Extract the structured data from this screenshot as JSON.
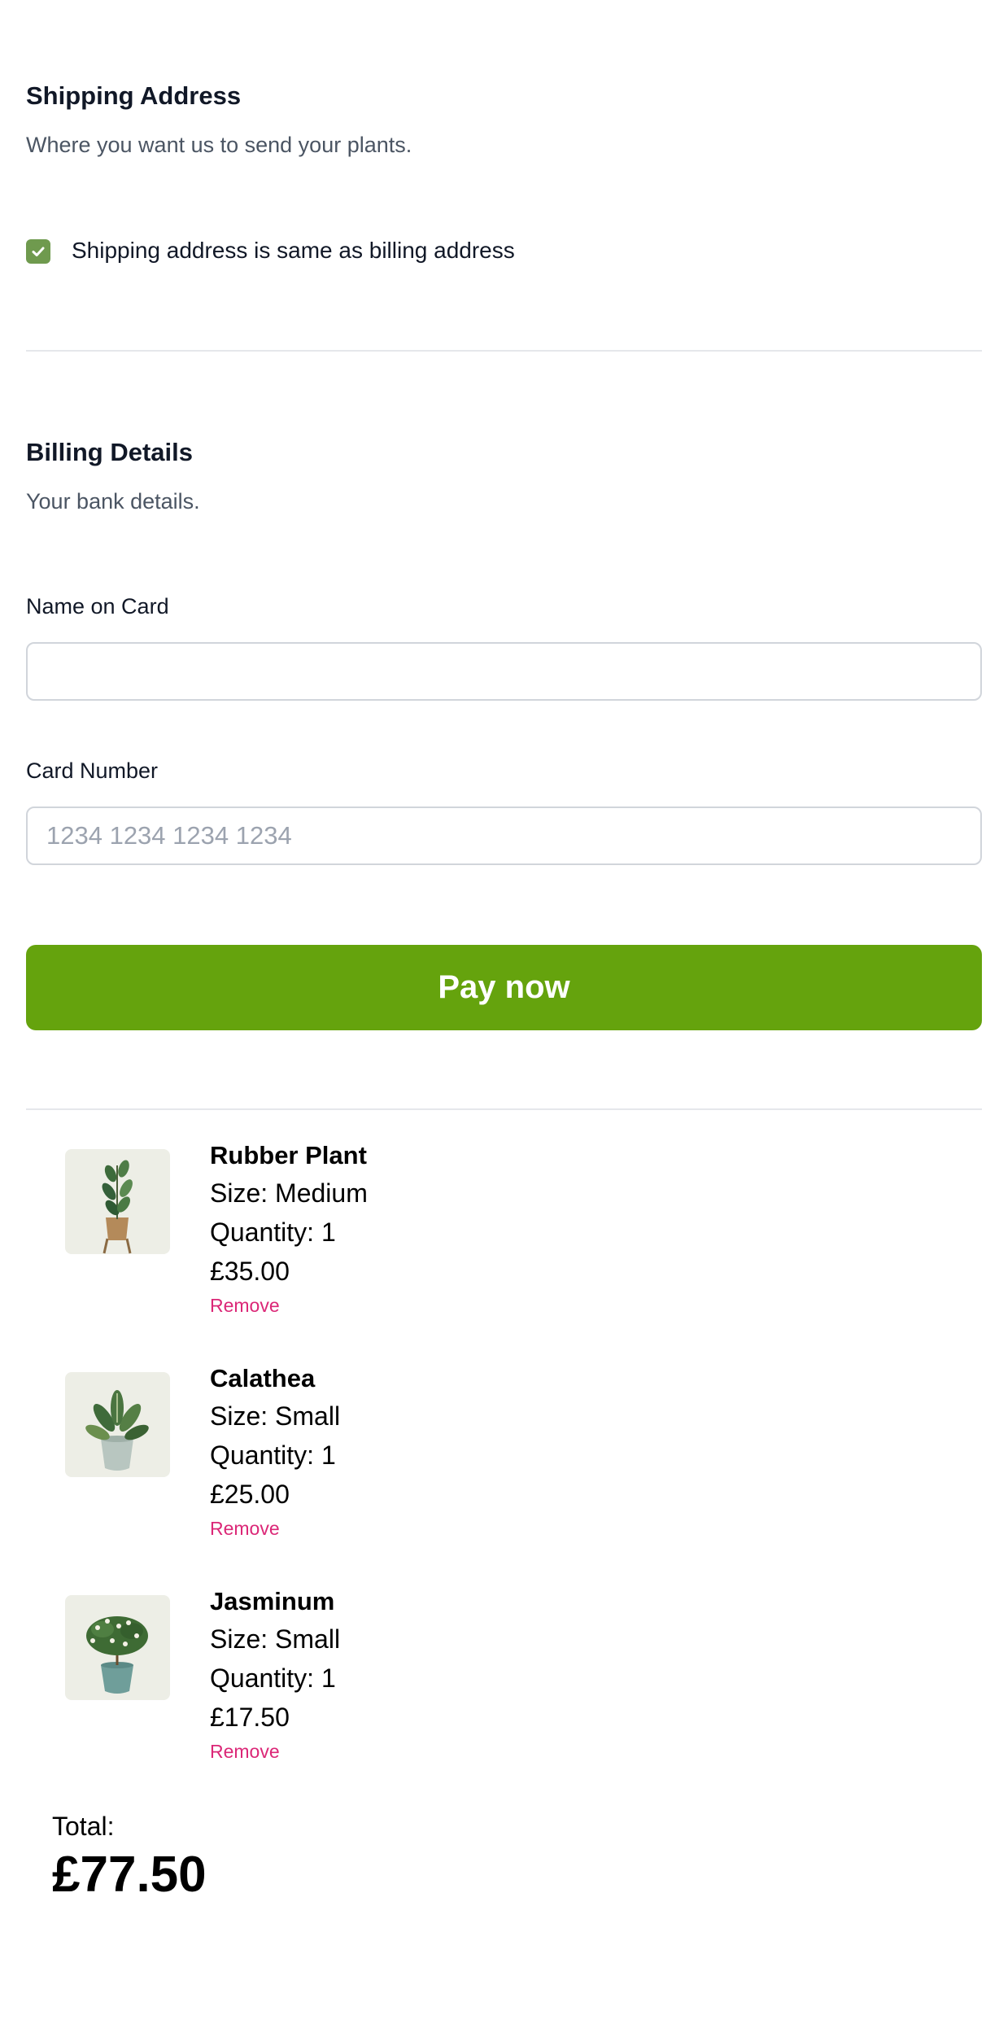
{
  "shipping": {
    "title": "Shipping Address",
    "subtitle": "Where you want us to send your plants.",
    "same_as_billing_label": "Shipping address is same as billing address",
    "same_as_billing_checked": true
  },
  "billing": {
    "title": "Billing Details",
    "subtitle": "Your bank details.",
    "name_label": "Name on Card",
    "name_value": "",
    "card_label": "Card Number",
    "card_placeholder": "1234 1234 1234 1234",
    "card_value": ""
  },
  "pay_button_label": "Pay now",
  "cart": {
    "items": [
      {
        "name": "Rubber Plant",
        "size": "Size: Medium",
        "quantity": "Quantity: 1",
        "price": "£35.00",
        "remove_label": "Remove",
        "icon": "rubber-plant-image"
      },
      {
        "name": "Calathea",
        "size": "Size: Small",
        "quantity": "Quantity: 1",
        "price": "£25.00",
        "remove_label": "Remove",
        "icon": "calathea-image"
      },
      {
        "name": "Jasminum",
        "size": "Size: Small",
        "quantity": "Quantity: 1",
        "price": "£17.50",
        "remove_label": "Remove",
        "icon": "jasminum-image"
      }
    ],
    "total_label": "Total:",
    "total_value": "£77.50"
  },
  "colors": {
    "accent": "#65a30d",
    "checkbox": "#6f9a4e",
    "remove_link": "#db2777",
    "divider": "#e5e7eb"
  }
}
